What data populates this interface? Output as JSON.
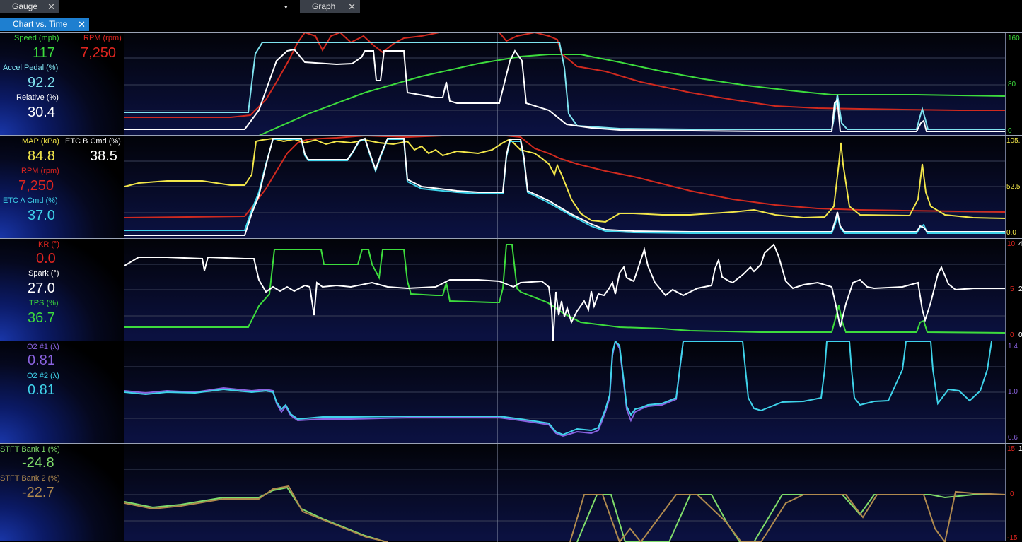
{
  "tabs": [
    {
      "label": "Gauge",
      "close": "✕"
    },
    {
      "label": "Graph",
      "close": "✕"
    }
  ],
  "dropdown_glyph": "▾",
  "subtab": {
    "label": "Chart vs. Time",
    "close": "✕"
  },
  "panels": [
    {
      "readouts": [
        {
          "label": "Speed (mph)",
          "value": "117",
          "color": "#3ddc3d"
        },
        {
          "label": "RPM (rpm)",
          "value": "7,250",
          "color": "#e0251f"
        },
        {
          "label": "Accel Pedal (%)",
          "value": "92.2",
          "color": "#7fe3ef"
        },
        {
          "label": "Relative (%)",
          "value": "30.4",
          "color": "#ffffff"
        }
      ],
      "scale": [
        "160",
        "80",
        "0"
      ],
      "scale_color": "#3ddc3d"
    },
    {
      "readouts": [
        {
          "label": "MAP (kPa)",
          "value": "84.8",
          "color": "#f2e64a"
        },
        {
          "label": "ETC B Cmd (%)",
          "value": "38.5",
          "color": "#ffffff"
        },
        {
          "label": "RPM (rpm)",
          "value": "7,250",
          "color": "#e0251f"
        },
        {
          "label": "ETC A Cmd (%)",
          "value": "37.0",
          "color": "#3fd3ea"
        }
      ],
      "scale": [
        "105.",
        "52.5",
        "0.0"
      ],
      "scale_color": "#f2e64a"
    },
    {
      "readouts": [
        {
          "label": "KR (°)",
          "value": "0.0",
          "color": "#e0251f"
        },
        {
          "label": "Spark (°)",
          "value": "27.0",
          "color": "#ffffff"
        },
        {
          "label": "TPS (%)",
          "value": "36.7",
          "color": "#3ddc3d"
        }
      ],
      "scale_red": [
        "10",
        "5",
        "0"
      ],
      "scale_white": [
        "4",
        "2",
        "0"
      ]
    },
    {
      "readouts": [
        {
          "label": "O2 #1 (λ)",
          "value": "0.81",
          "color": "#8a63e0"
        },
        {
          "label": "O2 #2 (λ)",
          "value": "0.81",
          "color": "#3fd3ea"
        }
      ],
      "scale": [
        "1.4",
        "1.0",
        "0.6"
      ],
      "scale_color": "#8a63e0"
    },
    {
      "readouts": [
        {
          "label": "STFT Bank 1 (%)",
          "value": "-24.8",
          "color": "#7fdc6a"
        },
        {
          "label": "STFT Bank 2 (%)",
          "value": "-22.7",
          "color": "#b08a4e"
        }
      ],
      "scale_red": [
        "15",
        "0",
        "-15"
      ],
      "scale_white": [
        "1",
        "",
        ""
      ]
    }
  ]
}
